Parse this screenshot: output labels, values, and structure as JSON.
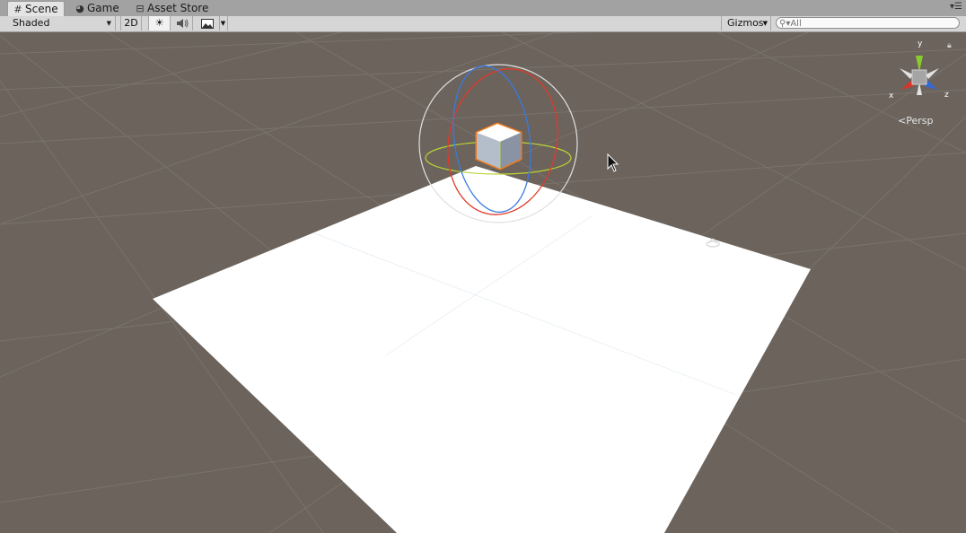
{
  "tabs": [
    {
      "label": "Scene",
      "icon": "grid-icon",
      "active": true
    },
    {
      "label": "Game",
      "icon": "pacman-icon",
      "active": false
    },
    {
      "label": "Asset Store",
      "icon": "store-bag-icon",
      "active": false
    }
  ],
  "toolbar": {
    "shading_mode": "Shaded",
    "mode_2d": "2D",
    "lighting_icon": "sun-icon",
    "audio_icon": "speaker-icon",
    "effects_icon": "image-icon",
    "gizmos_label": "Gizmos",
    "search_placeholder": "All"
  },
  "scene": {
    "projection_label": "Persp",
    "axis_labels": {
      "x": "x",
      "y": "y",
      "z": "z"
    },
    "background_color": "#6b635c",
    "grid_color": "#7a736c",
    "plane_color": "#ffffff",
    "selected_object": "cube",
    "selection_outline_color": "#f07a1a",
    "rotation_gizmo_colors": {
      "x": "#e03a2a",
      "y": "#b6d334",
      "z": "#3a7ae0",
      "view": "#e0e0e0"
    }
  }
}
